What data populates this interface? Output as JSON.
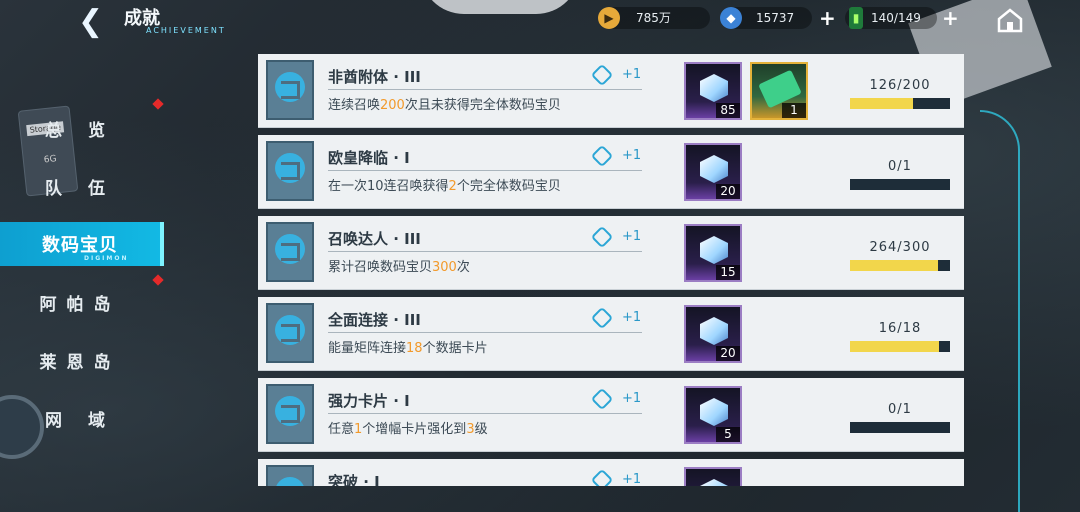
{
  "header": {
    "title": "成就",
    "subtitle": "ACHIEVEMENT"
  },
  "resources": [
    {
      "icon": "play-coin-icon",
      "value": "785万"
    },
    {
      "icon": "cube-icon",
      "value": "15737"
    },
    {
      "icon": "battery-icon",
      "value": "140/149"
    }
  ],
  "sidebar": {
    "items": [
      {
        "label": "总 览",
        "name": "overview"
      },
      {
        "label": "队 伍",
        "name": "team"
      },
      {
        "label": "数码宝贝",
        "name": "digimon",
        "en": "DIGIMON"
      },
      {
        "label": "阿帕岛",
        "name": "apa-island"
      },
      {
        "label": "莱恩岛",
        "name": "lain-island"
      },
      {
        "label": "网 域",
        "name": "net-domain"
      }
    ]
  },
  "colors": {
    "accent": "#12b9e4",
    "highlight": "#f29a2c",
    "progress": "#f2d64b",
    "badge": "#e52a2a"
  },
  "achievements": [
    {
      "name": "非酋附体 · III",
      "desc": [
        "连续召唤",
        "200",
        "次且未获得完全体数码宝贝"
      ],
      "points": "+1",
      "rewards": [
        {
          "type": "cube",
          "count": "85"
        },
        {
          "type": "ticket",
          "count": "1"
        }
      ],
      "progress": "126/200",
      "ratio": 0.63
    },
    {
      "name": "欧皇降临 · I",
      "desc": [
        "在一次10连召唤获得",
        "2",
        "个完全体数码宝贝"
      ],
      "points": "+1",
      "rewards": [
        {
          "type": "cube",
          "count": "20"
        }
      ],
      "progress": "0/1",
      "ratio": 0
    },
    {
      "name": "召唤达人 · III",
      "desc": [
        "累计召唤数码宝贝",
        "300",
        "次"
      ],
      "points": "+1",
      "rewards": [
        {
          "type": "cube",
          "count": "15"
        }
      ],
      "progress": "264/300",
      "ratio": 0.88
    },
    {
      "name": "全面连接 · III",
      "desc": [
        "能量矩阵连接",
        "18",
        "个数据卡片"
      ],
      "points": "+1",
      "rewards": [
        {
          "type": "cube",
          "count": "20"
        }
      ],
      "progress": "16/18",
      "ratio": 0.89
    },
    {
      "name": "强力卡片 · I",
      "desc": [
        "任意",
        "1",
        "个增幅卡片强化到",
        "3",
        "级"
      ],
      "points": "+1",
      "rewards": [
        {
          "type": "cube",
          "count": "5"
        }
      ],
      "progress": "0/1",
      "ratio": 0
    },
    {
      "name": "突破 · I",
      "desc": [
        ""
      ],
      "points": "+1",
      "rewards": [
        {
          "type": "cube",
          "count": ""
        }
      ],
      "progress": "",
      "ratio": 0
    }
  ]
}
